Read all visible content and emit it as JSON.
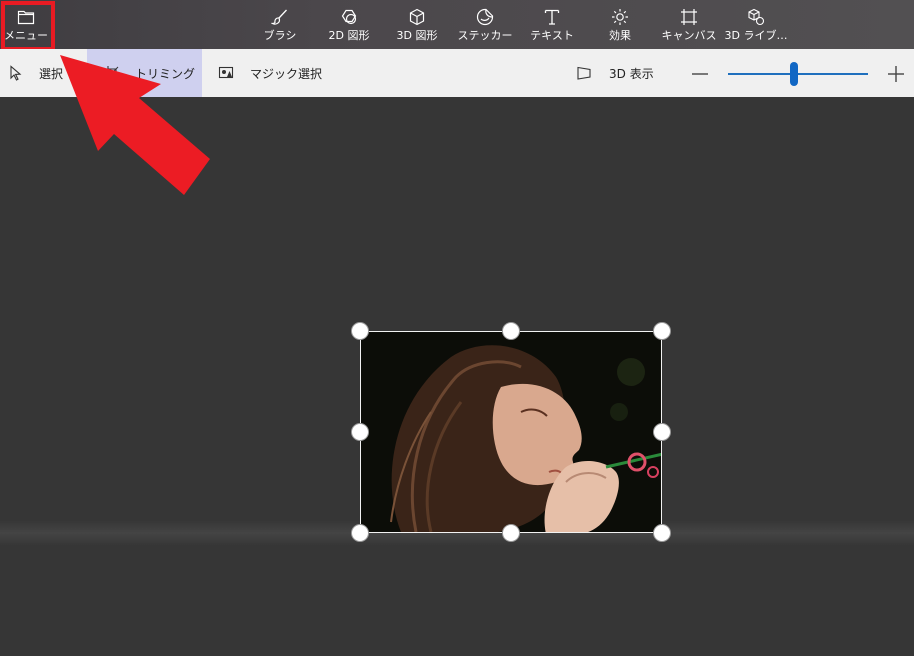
{
  "toolbar": {
    "menu_label": "メニュー",
    "tools": [
      {
        "label": "ブラシ",
        "icon": "brush-icon"
      },
      {
        "label": "2D 図形",
        "icon": "2d-shapes-icon"
      },
      {
        "label": "3D 図形",
        "icon": "3d-shapes-icon"
      },
      {
        "label": "ステッカー",
        "icon": "sticker-icon"
      },
      {
        "label": "テキスト",
        "icon": "text-icon"
      },
      {
        "label": "効果",
        "icon": "effects-icon"
      },
      {
        "label": "キャンバス",
        "icon": "canvas-icon"
      },
      {
        "label": "3D ライブ…",
        "icon": "3d-library-icon"
      }
    ]
  },
  "subbar": {
    "select_label": "選択",
    "trim_label": "トリミング",
    "magic_select_label": "マジック選択",
    "view3d_label": "3D 表示",
    "zoom_level": 0.47
  },
  "colors": {
    "highlight": "#e81b23",
    "accent": "#1167c4",
    "canvas_bg": "#363636"
  }
}
